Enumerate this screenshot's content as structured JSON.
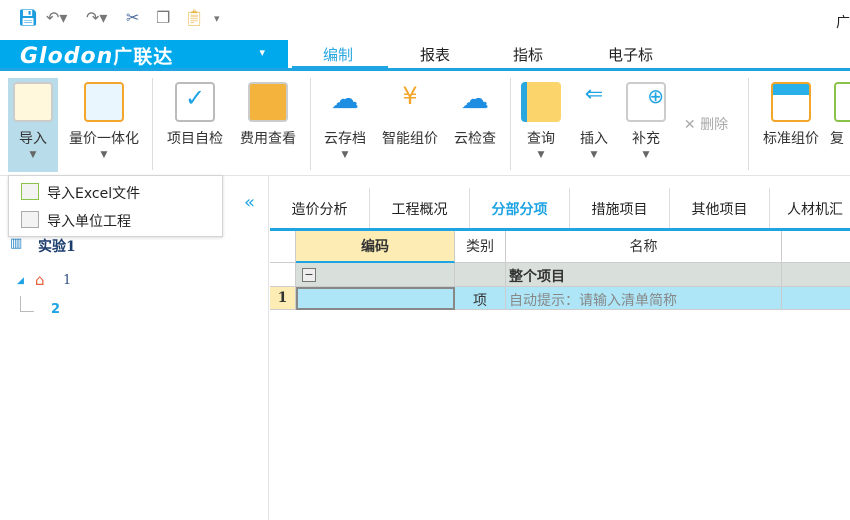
{
  "quick_access": {
    "icons": [
      "save-icon",
      "undo-icon",
      "redo-icon",
      "cut-icon",
      "copy-icon",
      "paste-icon",
      "customize-icon"
    ],
    "title_fragment": "广"
  },
  "brand": {
    "logo_text": "Glodon",
    "logo_cn": "广联达",
    "dropdown": "▾"
  },
  "main_tabs": [
    {
      "label": "编制",
      "active": true
    },
    {
      "label": "报表"
    },
    {
      "label": "指标"
    },
    {
      "label": "电子标"
    }
  ],
  "ribbon": {
    "buttons": [
      {
        "label": "导入",
        "icon": "import-icon",
        "dropdown": true,
        "active": true
      },
      {
        "label": "量价一体化",
        "icon": "quantity-price-icon",
        "dropdown": true
      },
      {
        "label": "项目自检",
        "icon": "self-check-icon"
      },
      {
        "label": "费用查看",
        "icon": "cost-view-icon"
      },
      {
        "label": "云存档",
        "icon": "cloud-save-icon",
        "dropdown": true
      },
      {
        "label": "智能组价",
        "icon": "smart-pricing-icon"
      },
      {
        "label": "云检查",
        "icon": "cloud-check-icon"
      },
      {
        "label": "查询",
        "icon": "query-icon",
        "dropdown": true
      },
      {
        "label": "插入",
        "icon": "insert-icon",
        "dropdown": true
      },
      {
        "label": "补充",
        "icon": "supplement-icon",
        "dropdown": true
      },
      {
        "label": "删除",
        "icon": "delete-icon",
        "disabled": true
      },
      {
        "label": "标准组价",
        "icon": "standard-pricing-icon"
      },
      {
        "label": "复",
        "icon": "copy-icon"
      }
    ]
  },
  "import_menu": {
    "items": [
      "导入Excel文件",
      "导入单位工程"
    ]
  },
  "tree": {
    "root": "实验1",
    "child": "1",
    "grandchild": "2",
    "collapse_icon": "«"
  },
  "sub_tabs": [
    {
      "label": "造价分析"
    },
    {
      "label": "工程概况"
    },
    {
      "label": "分部分项",
      "active": true
    },
    {
      "label": "措施项目"
    },
    {
      "label": "其他项目"
    },
    {
      "label": "人材机汇"
    }
  ],
  "grid": {
    "headers": [
      "编码",
      "类别",
      "名称"
    ],
    "group_row": {
      "name": "整个项目",
      "toggle": "−"
    },
    "rows": [
      {
        "num": "1",
        "code": "",
        "type": "项",
        "name": "自动提示：请输入清单简称"
      }
    ]
  },
  "colors": {
    "accent": "#1ea3e3",
    "brand": "#00a8ec",
    "selected_row": "#aee6f8",
    "header_highlight": "#fdedb4"
  }
}
